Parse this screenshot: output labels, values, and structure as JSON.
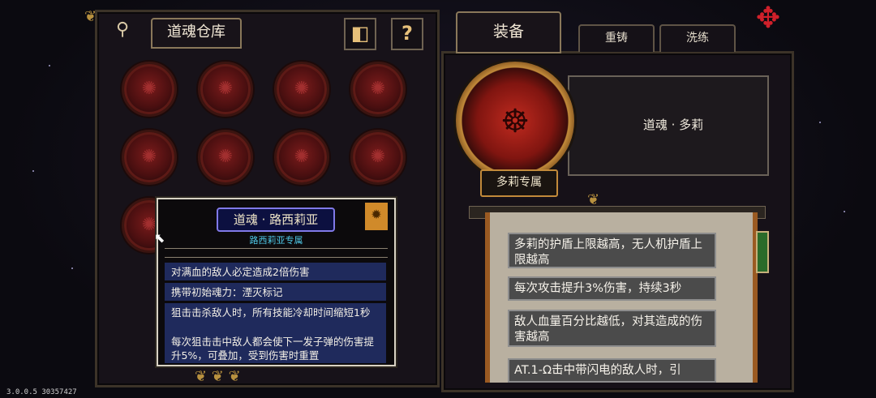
{
  "left_panel": {
    "title": "道魂仓库",
    "tag_icon": "tag-icon",
    "shape_button_icon": "tangram-icon",
    "help_button_label": "?"
  },
  "tooltip": {
    "title": "道魂 · 路西莉亚",
    "subtitle": "路西莉亚专属",
    "badge_icon": "gear-badge-icon",
    "effects": [
      "对满血的敌人必定造成2倍伤害",
      "携带初始魂力：湮灭标记",
      "狙击击杀敌人时，所有技能冷却时间缩短1秒",
      "每次狙击击中敌人都会使下一发子弹的伤害提升5%，可叠加，受到伤害时重置"
    ]
  },
  "right_panel": {
    "tabs": [
      {
        "label": "装备"
      },
      {
        "label": "重铸"
      },
      {
        "label": "洗练"
      }
    ],
    "item_name": "道魂 · 多莉",
    "exclusive_label": "多莉专属",
    "effects": [
      "多莉的护盾上限越高，无人机护盾上限越高",
      "每次攻击提升3%伤害，持续3秒",
      "敌人血量百分比越低，对其造成的伤害越高",
      "AT.1-Ω击中带闪电的敌人时，引"
    ]
  },
  "version": "3.0.0.5 30357427",
  "colors": {
    "soul_red": "#7a1b1b",
    "gold_trim": "#c28a3a",
    "tooltip_item_bg": "#1f2a5c",
    "tooltip_title_border": "#8079e8",
    "effect_box_bg": "#4b4b4b"
  }
}
